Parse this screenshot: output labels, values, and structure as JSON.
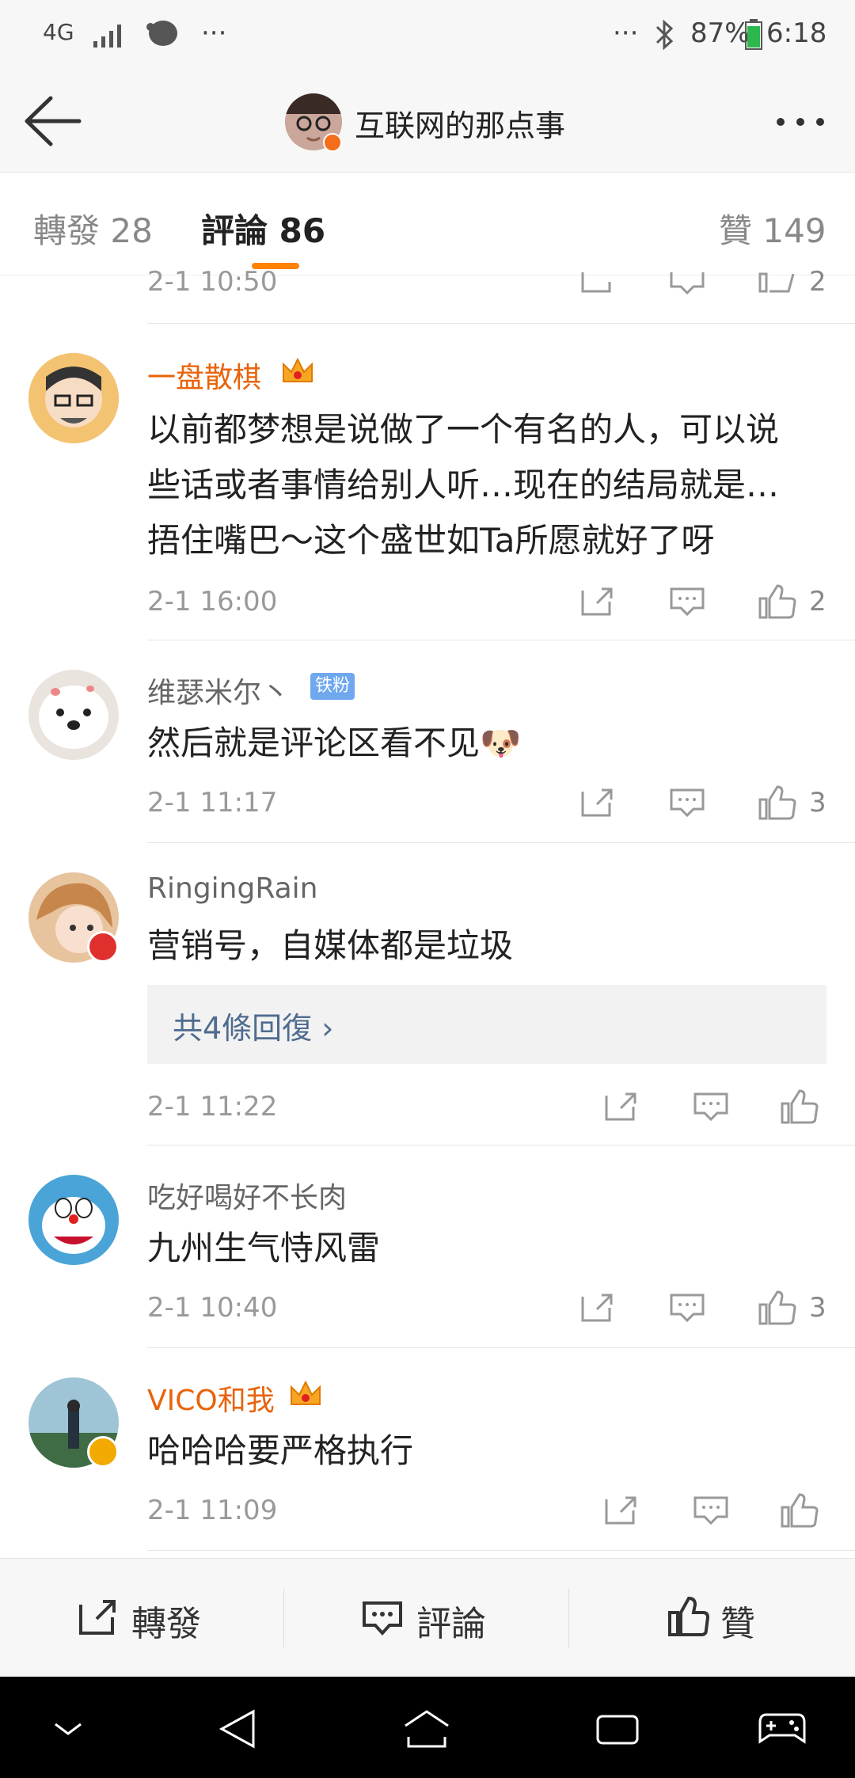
{
  "status": {
    "network": "4G",
    "battery": "87%",
    "time": "6:18",
    "more_left": "···",
    "more_right": "···"
  },
  "header": {
    "title": "互联网的那点事",
    "back_icon": "arrow-left-icon",
    "more_icon": "more-dots-icon"
  },
  "tabs": {
    "reposts": "轉發 28",
    "comments": "評論 86",
    "likes": "贊 149"
  },
  "partial": {
    "time": "2-1 10:50",
    "likes": "2"
  },
  "comments": [
    {
      "name": "一盘散棋",
      "text_lines": [
        "以前都梦想是说做了一个有名的人，可以说",
        "些话或者事情给别人听…现在的结局就是…",
        "捂住嘴巴～这个盛世如Ta所愿就好了呀"
      ],
      "time": "2-1 16:00",
      "likes": "2",
      "name_color": "#e8630a"
    },
    {
      "name": "维瑟米尔丶",
      "badge": "铁粉",
      "text_lines": [
        "然后就是评论区看不见🐶"
      ],
      "time": "2-1 11:17",
      "likes": "3",
      "name_color": "#666666"
    },
    {
      "name": "RingingRain",
      "text_lines": [
        "营销号，自媒体都是垃圾"
      ],
      "replies": "共4條回復 ›",
      "time": "2-1 11:22",
      "likes": "",
      "name_color": "#666666"
    },
    {
      "name": "吃好喝好不长肉",
      "text_lines": [
        "九州生气恃风雷"
      ],
      "time": "2-1 10:40",
      "likes": "3",
      "name_color": "#666666"
    },
    {
      "name": "VICO和我",
      "text_lines": [
        "哈哈哈要严格执行"
      ],
      "time": "2-1 11:09",
      "likes": "",
      "name_color": "#e8630a"
    }
  ],
  "bottom": {
    "repost": "轉發",
    "comment": "評論",
    "like": "贊"
  },
  "colors": {
    "accent": "#ff8200",
    "vip_name": "#e8630a",
    "link": "#4e6c8f"
  }
}
